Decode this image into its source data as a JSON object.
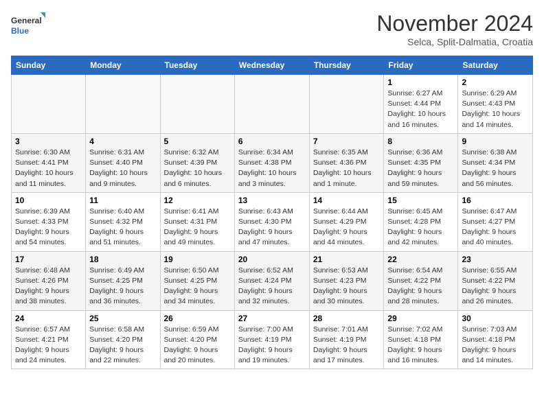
{
  "logo": {
    "general": "General",
    "blue": "Blue"
  },
  "title": "November 2024",
  "subtitle": "Selca, Split-Dalmatia, Croatia",
  "days_of_week": [
    "Sunday",
    "Monday",
    "Tuesday",
    "Wednesday",
    "Thursday",
    "Friday",
    "Saturday"
  ],
  "weeks": [
    [
      {
        "day": "",
        "info": ""
      },
      {
        "day": "",
        "info": ""
      },
      {
        "day": "",
        "info": ""
      },
      {
        "day": "",
        "info": ""
      },
      {
        "day": "",
        "info": ""
      },
      {
        "day": "1",
        "info": "Sunrise: 6:27 AM\nSunset: 4:44 PM\nDaylight: 10 hours and 16 minutes."
      },
      {
        "day": "2",
        "info": "Sunrise: 6:29 AM\nSunset: 4:43 PM\nDaylight: 10 hours and 14 minutes."
      }
    ],
    [
      {
        "day": "3",
        "info": "Sunrise: 6:30 AM\nSunset: 4:41 PM\nDaylight: 10 hours and 11 minutes."
      },
      {
        "day": "4",
        "info": "Sunrise: 6:31 AM\nSunset: 4:40 PM\nDaylight: 10 hours and 9 minutes."
      },
      {
        "day": "5",
        "info": "Sunrise: 6:32 AM\nSunset: 4:39 PM\nDaylight: 10 hours and 6 minutes."
      },
      {
        "day": "6",
        "info": "Sunrise: 6:34 AM\nSunset: 4:38 PM\nDaylight: 10 hours and 3 minutes."
      },
      {
        "day": "7",
        "info": "Sunrise: 6:35 AM\nSunset: 4:36 PM\nDaylight: 10 hours and 1 minute."
      },
      {
        "day": "8",
        "info": "Sunrise: 6:36 AM\nSunset: 4:35 PM\nDaylight: 9 hours and 59 minutes."
      },
      {
        "day": "9",
        "info": "Sunrise: 6:38 AM\nSunset: 4:34 PM\nDaylight: 9 hours and 56 minutes."
      }
    ],
    [
      {
        "day": "10",
        "info": "Sunrise: 6:39 AM\nSunset: 4:33 PM\nDaylight: 9 hours and 54 minutes."
      },
      {
        "day": "11",
        "info": "Sunrise: 6:40 AM\nSunset: 4:32 PM\nDaylight: 9 hours and 51 minutes."
      },
      {
        "day": "12",
        "info": "Sunrise: 6:41 AM\nSunset: 4:31 PM\nDaylight: 9 hours and 49 minutes."
      },
      {
        "day": "13",
        "info": "Sunrise: 6:43 AM\nSunset: 4:30 PM\nDaylight: 9 hours and 47 minutes."
      },
      {
        "day": "14",
        "info": "Sunrise: 6:44 AM\nSunset: 4:29 PM\nDaylight: 9 hours and 44 minutes."
      },
      {
        "day": "15",
        "info": "Sunrise: 6:45 AM\nSunset: 4:28 PM\nDaylight: 9 hours and 42 minutes."
      },
      {
        "day": "16",
        "info": "Sunrise: 6:47 AM\nSunset: 4:27 PM\nDaylight: 9 hours and 40 minutes."
      }
    ],
    [
      {
        "day": "17",
        "info": "Sunrise: 6:48 AM\nSunset: 4:26 PM\nDaylight: 9 hours and 38 minutes."
      },
      {
        "day": "18",
        "info": "Sunrise: 6:49 AM\nSunset: 4:25 PM\nDaylight: 9 hours and 36 minutes."
      },
      {
        "day": "19",
        "info": "Sunrise: 6:50 AM\nSunset: 4:25 PM\nDaylight: 9 hours and 34 minutes."
      },
      {
        "day": "20",
        "info": "Sunrise: 6:52 AM\nSunset: 4:24 PM\nDaylight: 9 hours and 32 minutes."
      },
      {
        "day": "21",
        "info": "Sunrise: 6:53 AM\nSunset: 4:23 PM\nDaylight: 9 hours and 30 minutes."
      },
      {
        "day": "22",
        "info": "Sunrise: 6:54 AM\nSunset: 4:22 PM\nDaylight: 9 hours and 28 minutes."
      },
      {
        "day": "23",
        "info": "Sunrise: 6:55 AM\nSunset: 4:22 PM\nDaylight: 9 hours and 26 minutes."
      }
    ],
    [
      {
        "day": "24",
        "info": "Sunrise: 6:57 AM\nSunset: 4:21 PM\nDaylight: 9 hours and 24 minutes."
      },
      {
        "day": "25",
        "info": "Sunrise: 6:58 AM\nSunset: 4:20 PM\nDaylight: 9 hours and 22 minutes."
      },
      {
        "day": "26",
        "info": "Sunrise: 6:59 AM\nSunset: 4:20 PM\nDaylight: 9 hours and 20 minutes."
      },
      {
        "day": "27",
        "info": "Sunrise: 7:00 AM\nSunset: 4:19 PM\nDaylight: 9 hours and 19 minutes."
      },
      {
        "day": "28",
        "info": "Sunrise: 7:01 AM\nSunset: 4:19 PM\nDaylight: 9 hours and 17 minutes."
      },
      {
        "day": "29",
        "info": "Sunrise: 7:02 AM\nSunset: 4:18 PM\nDaylight: 9 hours and 16 minutes."
      },
      {
        "day": "30",
        "info": "Sunrise: 7:03 AM\nSunset: 4:18 PM\nDaylight: 9 hours and 14 minutes."
      }
    ]
  ]
}
